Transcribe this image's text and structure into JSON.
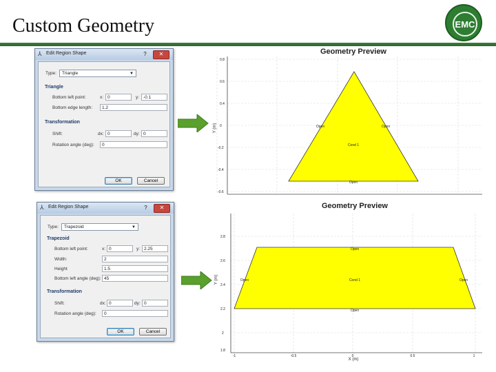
{
  "slide": {
    "title": "Custom Geometry",
    "logo_text": "EMC"
  },
  "dialog1": {
    "title": "Edit Region Shape",
    "type_label": "Type:",
    "type_value": "Triangle",
    "section1": "Triangle",
    "bl_label": "Bottom left point:",
    "x_label": "x:",
    "x_value": "0",
    "y_label": "y:",
    "y_value": "-0.1",
    "edge_label": "Bottom edge length:",
    "edge_value": "1.2",
    "section2": "Transformation",
    "shift_label": "Shift:",
    "dx_label": "dx:",
    "dx_value": "0",
    "dy_label": "dy:",
    "dy_value": "0",
    "rot_label": "Rotation angle (deg):",
    "rot_value": "0",
    "ok": "OK",
    "cancel": "Cancel"
  },
  "dialog2": {
    "title": "Edit Region Shape",
    "type_label": "Type:",
    "type_value": "Trapezoid",
    "section1": "Trapezoid",
    "bl_label": "Bottom left point:",
    "x_label": "x:",
    "x_value": "0",
    "y_label": "y:",
    "y_value": "2.25",
    "width_label": "Width:",
    "width_value": "2",
    "height_label": "Height",
    "height_value": "1.5",
    "angle_label": "Bottom left angle (deg):",
    "angle_value": "45",
    "section2": "Transformation",
    "shift_label": "Shift:",
    "dx_label": "dx:",
    "dx_value": "0",
    "dy_label": "dy:",
    "dy_value": "0",
    "rot_label": "Rotation angle (deg):",
    "rot_value": "0",
    "ok": "OK",
    "cancel": "Cancel"
  },
  "preview1": {
    "title": "Geometry Preview",
    "ylabel": "Y (m)",
    "yticks": [
      "0.8",
      "0.6",
      "0.4",
      "0",
      "-0.2",
      "-0.4",
      "-0.6"
    ],
    "region_label": "Cond 1",
    "edge_labels": [
      "Open",
      "Open",
      "Open"
    ],
    "fill": "#ffff00"
  },
  "preview2": {
    "title": "Geometry Preview",
    "ylabel": "Y (m)",
    "xlabel": "X (m)",
    "yticks": [
      "2.8",
      "2.6",
      "2.4",
      "2.2",
      "2",
      "1.8"
    ],
    "xticks": [
      "-1",
      "-0.5",
      "0",
      "0.5",
      "1"
    ],
    "region_label": "Cond 1",
    "edge_labels": [
      "Open",
      "Open",
      "Open",
      "Open"
    ],
    "fill": "#ffff00"
  },
  "arrow_color": "#5aa02c"
}
